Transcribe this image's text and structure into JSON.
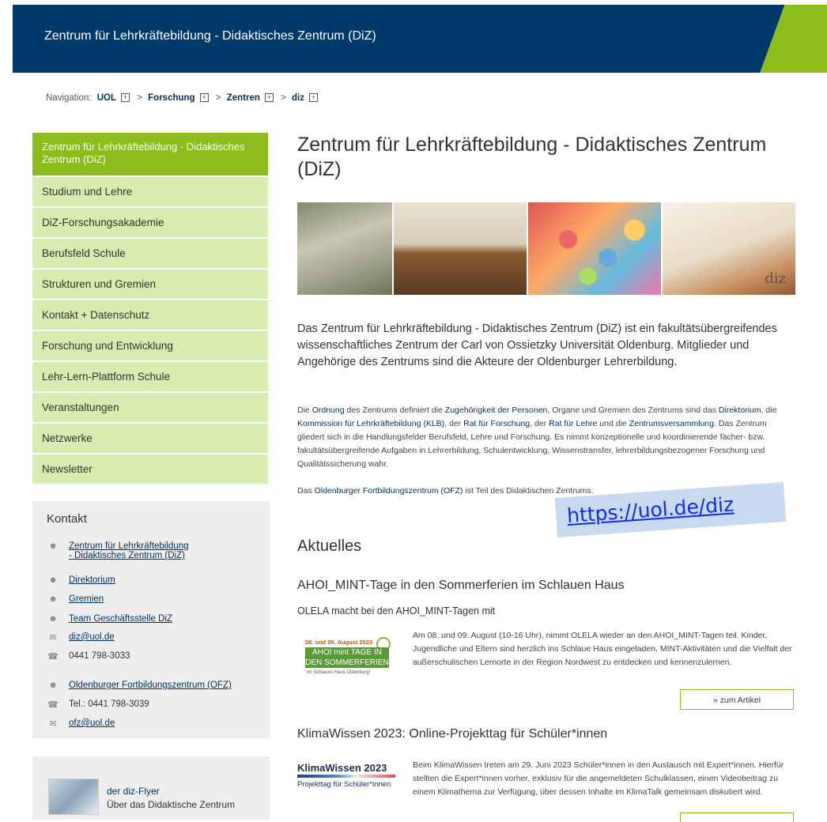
{
  "header": {
    "title": "Zentrum für Lehrkräftebildung - Didaktisches Zentrum (DiZ)"
  },
  "breadcrumb": {
    "label": "Navigation:",
    "items": [
      "UOL",
      "Forschung",
      "Zentren",
      "diz"
    ],
    "separator": ">"
  },
  "sidebar": {
    "items": [
      {
        "label": "Zentrum für Lehrkräftebildung - Didaktisches Zentrum (DiZ)",
        "active": true
      },
      {
        "label": "Studium und Lehre"
      },
      {
        "label": "DiZ-Forschungsakademie"
      },
      {
        "label": "Berufsfeld Schule"
      },
      {
        "label": "Strukturen und Gremien"
      },
      {
        "label": "Kontakt + Datenschutz"
      },
      {
        "label": "Forschung und Entwicklung"
      },
      {
        "label": "Lehr-Lern-Plattform Schule"
      },
      {
        "label": "Veranstaltungen"
      },
      {
        "label": "Netzwerke"
      },
      {
        "label": "Newsletter"
      }
    ]
  },
  "kontakt": {
    "title": "Kontakt",
    "items": [
      {
        "icon": "group-icon",
        "text": "Zentrum für Lehrkräftebildung",
        "text2": "- Didaktisches Zentrum (DiZ)",
        "link": true
      },
      {
        "icon": "group-icon",
        "text": "Direktorium",
        "link": true
      },
      {
        "icon": "group-icon",
        "text": "Gremien",
        "link": true
      },
      {
        "icon": "group-icon",
        "text": "Team Geschäftsstelle DiZ",
        "link": true
      },
      {
        "icon": "mail-icon",
        "text": "diz@uol.de",
        "link": true
      },
      {
        "icon": "phone-icon",
        "text": "0441 798-3033",
        "link": false
      },
      {
        "icon": "group-icon",
        "text": "Oldenburger Fortbildungszentrum (OFZ)",
        "link": true
      },
      {
        "icon": "phone-icon",
        "text": "Tel.: 0441 798-3039",
        "link": false
      },
      {
        "icon": "mail-icon",
        "text": "ofz@uol.de",
        "link": true
      }
    ]
  },
  "flyer": {
    "link": "der diz-Flyer",
    "text": "Über das Didaktische Zentrum"
  },
  "main": {
    "title": "Zentrum für Lehrkräftebildung - Didaktisches Zentrum (DiZ)",
    "banner_logo": "diz",
    "intro": "Das Zentrum für Lehrkräftebildung - Didaktisches Zentrum (DiZ) ist ein fakultätsübergreifendes wissenschaftliches Zentrum der Carl von Ossietzky Universität Oldenburg. Mitglieder und Angehörige des Zentrums sind die Akteure der Oldenburger Lehrerbildung.",
    "p1": {
      "t1": "Die ",
      "l1": "Ordnung",
      "t2": " des Zentrums definiert die ",
      "l2": "Zugehörigkeit der Personen,",
      "t3": " Organe und Gremien des Zentrums sind das ",
      "l3": "Direktorium",
      "t4": ", die ",
      "l4": "Kommission für Lehrkräftebildung (KLB)",
      "t5": ", der ",
      "l5": "Rat für Forschung",
      "t6": ", der ",
      "l6": "Rat für Lehre",
      "t7": " und die ",
      "l7": "Zentrumsversammlung",
      "t8": ". Das Zentrum gliedert sich in die Handlungsfelder Berufsfeld, Lehre und Forschung. Es nimmt konzeptionelle und koordinierende fächer- bzw. fakultätsübergreifende Aufgaben in Lehrerbildung, Schulentwicklung, Wissenstransfer, lehrerbildungsbezogener Forschung und Qualitätssicherung wahr."
    },
    "p2": {
      "t1": "Das ",
      "l1": "Oldenburger Fortbildungszentrum (OFZ)",
      "t2": " ist Teil des Didaktischen Zentrums."
    },
    "url_note": "https://uol.de/diz",
    "aktuelles": "Aktuelles",
    "news": [
      {
        "title": "AHOI_MINT-Tage in den Sommerferien im Schlauen Haus",
        "subtitle": "OLELA macht bei den AHOI_MINT-Tagen mit",
        "img_top": "08. und 09. August 2023",
        "img_mid": "AHOI mint TAGE IN DEN SOMMERFERIEN",
        "img_bot": "im Schlauen Haus Oldenburg!",
        "text": "Am 08. und 09. August (10-16 Uhr), nimmt OLELA wieder an den AHOI_MINT-Tagen teil. Kinder, Jugendliche und Eltern sind herzlich ins Schlaue Haus eingeladen, MINT-Aktivitäten und die Vielfalt der außerschulischen Lernorte in der Region Nordwest zu entdecken und kennenzulernen.",
        "button": "» zum Artikel"
      },
      {
        "title": "KlimaWissen 2023: Online-Projekttag für Schüler*innen",
        "img_top": "KlimaWissen 2023",
        "img_bot": "Projekttag für Schüler*innen",
        "text": "Beim KlimaWissen treten am 29. Juni 2023 Schüler*innen in den Austausch mit Expert*innen. Hierfür stellten die Expert*innen vorher, exklusiv für die angemeldeten Schulklassen, einen Videobeitrag zu einem Klimathema zur Verfügung, über dessen Inhalte im KlimaTalk gemeinsam diskutiert wird."
      }
    ]
  }
}
